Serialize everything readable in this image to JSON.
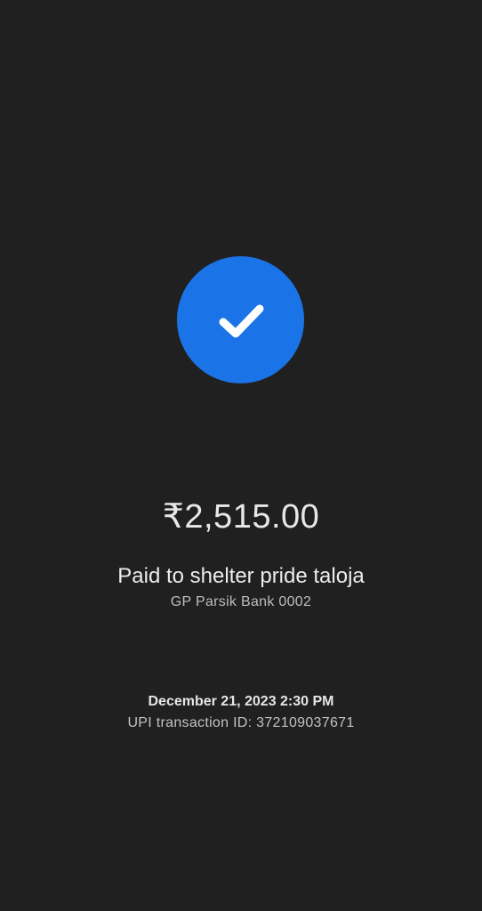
{
  "payment": {
    "status_icon": "checkmark-icon",
    "accent_color": "#1b73e8",
    "amount": "₹2,515.00",
    "payee_line": "Paid to shelter pride taloja",
    "bank_line": "GP Parsik Bank 0002",
    "datetime": "December 21, 2023 2:30 PM",
    "transaction_line": "UPI transaction ID: 372109037671"
  }
}
